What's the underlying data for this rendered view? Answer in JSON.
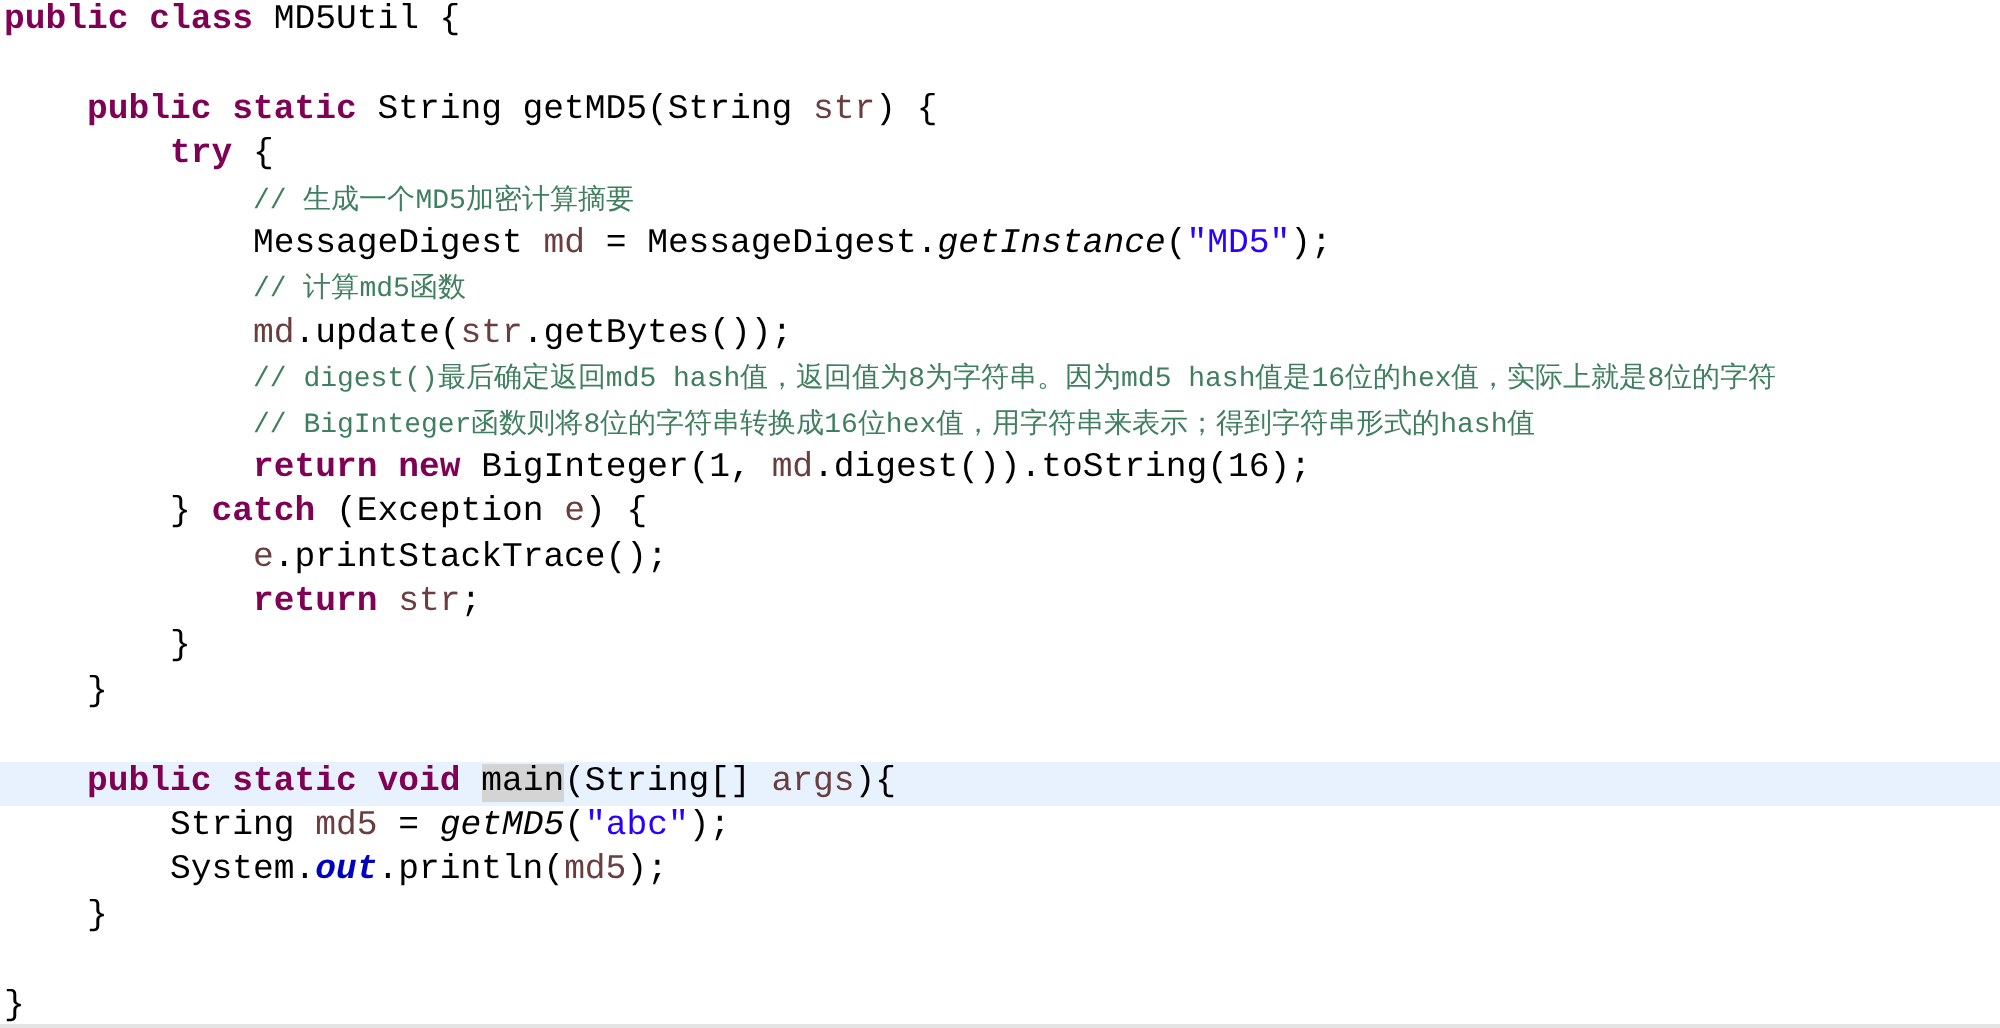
{
  "editor": {
    "lines": [
      {
        "kind": "code",
        "highlighted": false,
        "tokens": [
          {
            "kind": "keyword",
            "text": "public"
          },
          {
            "kind": "keyword",
            "text": "class",
            "space_before": true
          },
          {
            "kind": "plain",
            "text": "MD5Util {",
            "space_before": true
          }
        ],
        "children": [
          {
            "kind": "blank"
          },
          {
            "kind": "code",
            "highlighted": false,
            "tokens": [
              {
                "kind": "keyword",
                "text": "public"
              },
              {
                "kind": "keyword",
                "text": "static",
                "space_before": true
              },
              {
                "kind": "plain",
                "text": "String getMD5(String",
                "space_before": true
              },
              {
                "kind": "variable",
                "text": "str",
                "space_before": true
              },
              {
                "kind": "plain",
                "text": ") {"
              }
            ],
            "children": [
              {
                "kind": "code",
                "highlighted": false,
                "tokens": [
                  {
                    "kind": "keyword",
                    "text": "try"
                  },
                  {
                    "kind": "plain",
                    "text": "{",
                    "space_before": true
                  }
                ],
                "children": [
                  {
                    "kind": "code",
                    "highlighted": false,
                    "tokens": [
                      {
                        "kind": "comment",
                        "text": "// 生成一个MD5加密计算摘要"
                      }
                    ]
                  },
                  {
                    "kind": "code",
                    "highlighted": false,
                    "tokens": [
                      {
                        "kind": "plain",
                        "text": "MessageDigest"
                      },
                      {
                        "kind": "variable",
                        "text": "md",
                        "space_before": true
                      },
                      {
                        "kind": "plain",
                        "text": "= MessageDigest.",
                        "space_before": true
                      },
                      {
                        "kind": "static_method",
                        "text": "getInstance"
                      },
                      {
                        "kind": "plain",
                        "text": "("
                      },
                      {
                        "kind": "string",
                        "text": "\"MD5\""
                      },
                      {
                        "kind": "plain",
                        "text": ");"
                      }
                    ]
                  },
                  {
                    "kind": "code",
                    "highlighted": false,
                    "tokens": [
                      {
                        "kind": "comment",
                        "text": "// 计算md5函数"
                      }
                    ]
                  },
                  {
                    "kind": "code",
                    "highlighted": false,
                    "tokens": [
                      {
                        "kind": "variable",
                        "text": "md"
                      },
                      {
                        "kind": "plain",
                        "text": ".update("
                      },
                      {
                        "kind": "variable",
                        "text": "str"
                      },
                      {
                        "kind": "plain",
                        "text": ".getBytes());"
                      }
                    ]
                  },
                  {
                    "kind": "code",
                    "highlighted": false,
                    "tokens": [
                      {
                        "kind": "comment",
                        "text": "// digest()最后确定返回md5 hash值，返回值为8为字符串。因为md5 hash值是16位的hex值，实际上就是8位的字符"
                      }
                    ]
                  },
                  {
                    "kind": "code",
                    "highlighted": false,
                    "tokens": [
                      {
                        "kind": "comment",
                        "text": "// BigInteger函数则将8位的字符串转换成16位hex值，用字符串来表示；得到字符串形式的hash值"
                      }
                    ]
                  },
                  {
                    "kind": "code",
                    "highlighted": false,
                    "tokens": [
                      {
                        "kind": "keyword",
                        "text": "return"
                      },
                      {
                        "kind": "keyword",
                        "text": "new",
                        "space_before": true
                      },
                      {
                        "kind": "plain",
                        "text": "BigInteger(1,",
                        "space_before": true
                      },
                      {
                        "kind": "variable",
                        "text": "md",
                        "space_before": true
                      },
                      {
                        "kind": "plain",
                        "text": ".digest()).toString(16);"
                      }
                    ]
                  }
                ]
              },
              {
                "kind": "code",
                "highlighted": false,
                "tokens": [
                  {
                    "kind": "plain",
                    "text": "}"
                  },
                  {
                    "kind": "keyword",
                    "text": "catch",
                    "space_before": true
                  },
                  {
                    "kind": "plain",
                    "text": "(Exception",
                    "space_before": true
                  },
                  {
                    "kind": "variable",
                    "text": "e",
                    "space_before": true
                  },
                  {
                    "kind": "plain",
                    "text": ") {"
                  }
                ],
                "children": [
                  {
                    "kind": "code",
                    "highlighted": false,
                    "tokens": [
                      {
                        "kind": "variable",
                        "text": "e"
                      },
                      {
                        "kind": "plain",
                        "text": ".printStackTrace();"
                      }
                    ]
                  },
                  {
                    "kind": "code",
                    "highlighted": false,
                    "tokens": [
                      {
                        "kind": "keyword",
                        "text": "return"
                      },
                      {
                        "kind": "variable",
                        "text": "str",
                        "space_before": true
                      },
                      {
                        "kind": "plain",
                        "text": ";"
                      }
                    ]
                  }
                ]
              },
              {
                "kind": "code",
                "highlighted": false,
                "tokens": [
                  {
                    "kind": "plain",
                    "text": "}"
                  }
                ]
              }
            ]
          },
          {
            "kind": "code",
            "highlighted": false,
            "tokens": [
              {
                "kind": "plain",
                "text": "}"
              }
            ]
          },
          {
            "kind": "blank"
          },
          {
            "kind": "code",
            "highlighted": true,
            "tokens": [
              {
                "kind": "keyword",
                "text": "public"
              },
              {
                "kind": "keyword",
                "text": "static",
                "space_before": true
              },
              {
                "kind": "keyword",
                "text": "void",
                "space_before": true
              },
              {
                "kind": "occurrence",
                "text": "main",
                "space_before": true
              },
              {
                "kind": "plain",
                "text": "(String[]"
              },
              {
                "kind": "variable",
                "text": "args",
                "space_before": true
              },
              {
                "kind": "plain",
                "text": "){"
              }
            ],
            "children": [
              {
                "kind": "code",
                "highlighted": false,
                "tokens": [
                  {
                    "kind": "plain",
                    "text": "String"
                  },
                  {
                    "kind": "variable",
                    "text": "md5",
                    "space_before": true
                  },
                  {
                    "kind": "plain",
                    "text": "=",
                    "space_before": true
                  },
                  {
                    "kind": "static_method",
                    "text": "getMD5",
                    "space_before": true
                  },
                  {
                    "kind": "plain",
                    "text": "("
                  },
                  {
                    "kind": "string",
                    "text": "\"abc\""
                  },
                  {
                    "kind": "plain",
                    "text": ");"
                  }
                ]
              },
              {
                "kind": "code",
                "highlighted": false,
                "tokens": [
                  {
                    "kind": "plain",
                    "text": "System."
                  },
                  {
                    "kind": "static_field",
                    "text": "out"
                  },
                  {
                    "kind": "plain",
                    "text": ".println("
                  },
                  {
                    "kind": "variable",
                    "text": "md5"
                  },
                  {
                    "kind": "plain",
                    "text": ");"
                  }
                ]
              }
            ]
          },
          {
            "kind": "code",
            "highlighted": false,
            "tokens": [
              {
                "kind": "plain",
                "text": "}"
              }
            ]
          },
          {
            "kind": "blank"
          }
        ]
      },
      {
        "kind": "code",
        "highlighted": false,
        "tokens": [
          {
            "kind": "plain",
            "text": "}"
          }
        ]
      }
    ]
  }
}
